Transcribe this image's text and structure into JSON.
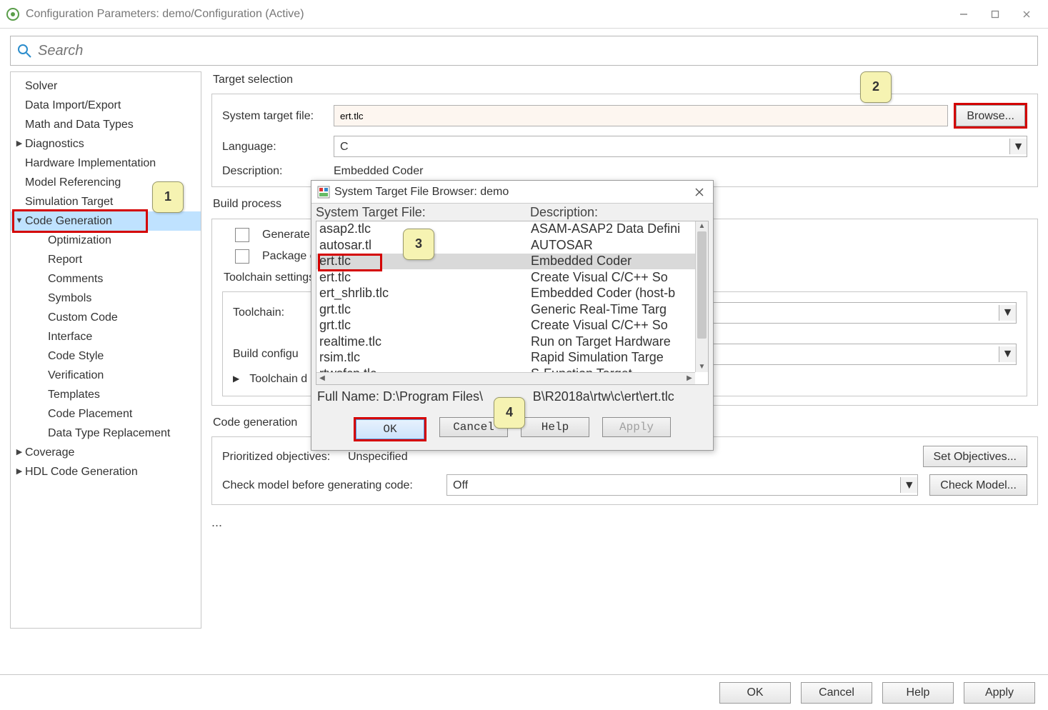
{
  "window": {
    "title": "Configuration Parameters: demo/Configuration (Active)"
  },
  "search": {
    "placeholder": "Search"
  },
  "sidebar": {
    "items": [
      {
        "label": "Solver",
        "kind": "top"
      },
      {
        "label": "Data Import/Export",
        "kind": "top"
      },
      {
        "label": "Math and Data Types",
        "kind": "top"
      },
      {
        "label": "Diagnostics",
        "kind": "caret"
      },
      {
        "label": "Hardware Implementation",
        "kind": "top"
      },
      {
        "label": "Model Referencing",
        "kind": "top"
      },
      {
        "label": "Simulation Target",
        "kind": "top"
      },
      {
        "label": "Code Generation",
        "kind": "caret",
        "selected": true,
        "hl": true
      },
      {
        "label": "Optimization",
        "kind": "sub"
      },
      {
        "label": "Report",
        "kind": "sub"
      },
      {
        "label": "Comments",
        "kind": "sub"
      },
      {
        "label": "Symbols",
        "kind": "sub"
      },
      {
        "label": "Custom Code",
        "kind": "sub"
      },
      {
        "label": "Interface",
        "kind": "sub"
      },
      {
        "label": "Code Style",
        "kind": "sub"
      },
      {
        "label": "Verification",
        "kind": "sub"
      },
      {
        "label": "Templates",
        "kind": "sub"
      },
      {
        "label": "Code Placement",
        "kind": "sub"
      },
      {
        "label": "Data Type Replacement",
        "kind": "sub"
      },
      {
        "label": "Coverage",
        "kind": "caret"
      },
      {
        "label": "HDL Code Generation",
        "kind": "caret"
      }
    ]
  },
  "main": {
    "target_section": "Target selection",
    "stf_label": "System target file:",
    "stf_value": "ert.tlc",
    "browse": "Browse...",
    "lang_label": "Language:",
    "lang_value": "C",
    "desc_label": "Description:",
    "desc_value": "Embedded Coder",
    "build_section": "Build process",
    "gen_label": "Generate c",
    "pkg_label": "Package co",
    "tc_section": "Toolchain settings",
    "tc_label": "Toolchain:",
    "bc_label": "Build configu",
    "tc_details": "Toolchain d",
    "objectives_section": "Code generation",
    "prio_label": "Prioritized objectives:",
    "prio_value": "Unspecified",
    "setobj": "Set Objectives...",
    "check_label": "Check model before generating code:",
    "check_value": "Off",
    "checkmodel": "Check Model...",
    "ellipsis": "..."
  },
  "dialog": {
    "title": "System Target File Browser: demo",
    "hdr_file": "System Target File:",
    "hdr_desc": "Description:",
    "rows": [
      {
        "file": "asap2.tlc",
        "desc": "ASAM-ASAP2 Data Defini"
      },
      {
        "file": "autosar.tl",
        "desc": "AUTOSAR"
      },
      {
        "file": "ert.tlc",
        "desc": "Embedded Coder",
        "sel": true,
        "hl": true
      },
      {
        "file": "ert.tlc",
        "desc": "Create Visual C/C++ So"
      },
      {
        "file": "ert_shrlib.tlc",
        "desc": "Embedded Coder (host-b"
      },
      {
        "file": "grt.tlc",
        "desc": "Generic Real-Time Targ"
      },
      {
        "file": "grt.tlc",
        "desc": "Create Visual C/C++ So"
      },
      {
        "file": "realtime.tlc",
        "desc": "Run on Target Hardware"
      },
      {
        "file": "rsim.tlc",
        "desc": "Rapid Simulation Targe"
      },
      {
        "file": "rtwsfcn.tlc",
        "desc": "S-Function Target"
      }
    ],
    "full_prefix": "Full Name: D:\\Program Files\\",
    "full_suffix": "B\\R2018a\\rtw\\c\\ert\\ert.tlc",
    "ok": "OK",
    "cancel": "Cancel",
    "help": "Help",
    "apply": "Apply"
  },
  "callouts": {
    "c1": "1",
    "c2": "2",
    "c3": "3",
    "c4": "4"
  },
  "bottom": {
    "ok": "OK",
    "cancel": "Cancel",
    "help": "Help",
    "apply": "Apply"
  }
}
